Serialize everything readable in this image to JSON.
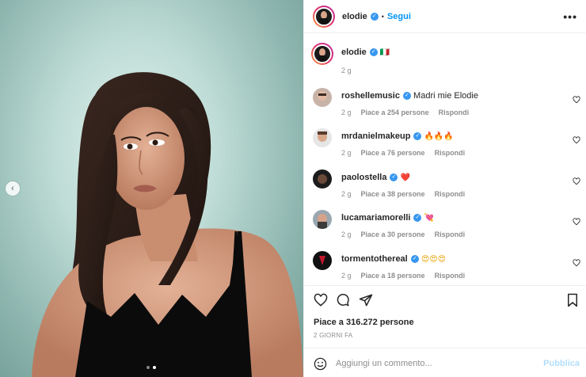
{
  "post": {
    "nav_prev_icon": "chevron-left-icon",
    "slide_count": 2,
    "active_slide": 2
  },
  "header": {
    "username": "elodie",
    "separator": "•",
    "follow_label": "Segui",
    "more_icon": "more-horizontal-icon",
    "more_label": "•••"
  },
  "caption": {
    "username": "elodie",
    "text": "🇮🇹",
    "time": "2 g"
  },
  "comments": [
    {
      "username": "roshellemusic",
      "text": "Madri mie Elodie",
      "time": "2 g",
      "likes": "Piace a 254 persone",
      "reply": "Rispondi"
    },
    {
      "username": "mrdanielmakeup",
      "text": "🔥🔥🔥",
      "time": "2 g",
      "likes": "Piace a 76 persone",
      "reply": "Rispondi"
    },
    {
      "username": "paolostella",
      "text": "❤️",
      "time": "2 g",
      "likes": "Piace a 38 persone",
      "reply": "Rispondi"
    },
    {
      "username": "lucamariamorelli",
      "text": "💘",
      "time": "2 g",
      "likes": "Piace a 30 persone",
      "reply": "Rispondi"
    },
    {
      "username": "tormentothereal",
      "text": "😍😍😍",
      "time": "2 g",
      "likes": "Piace a 18 persone",
      "reply": "Rispondi"
    }
  ],
  "actions": {
    "like_icon": "heart-icon",
    "comment_icon": "comment-icon",
    "share_icon": "send-icon",
    "save_icon": "bookmark-icon"
  },
  "likes_text": "Piace a 316.272 persone",
  "date_text": "2 GIORNI FA",
  "add_comment": {
    "placeholder": "Aggiungi un commento...",
    "publish_label": "Pubblica",
    "emoji_icon": "smiley-icon"
  },
  "colors": {
    "accent": "#0095f6",
    "verified": "#3897f0",
    "muted": "#8e8e8e",
    "publish_disabled": "#b2dffc"
  }
}
